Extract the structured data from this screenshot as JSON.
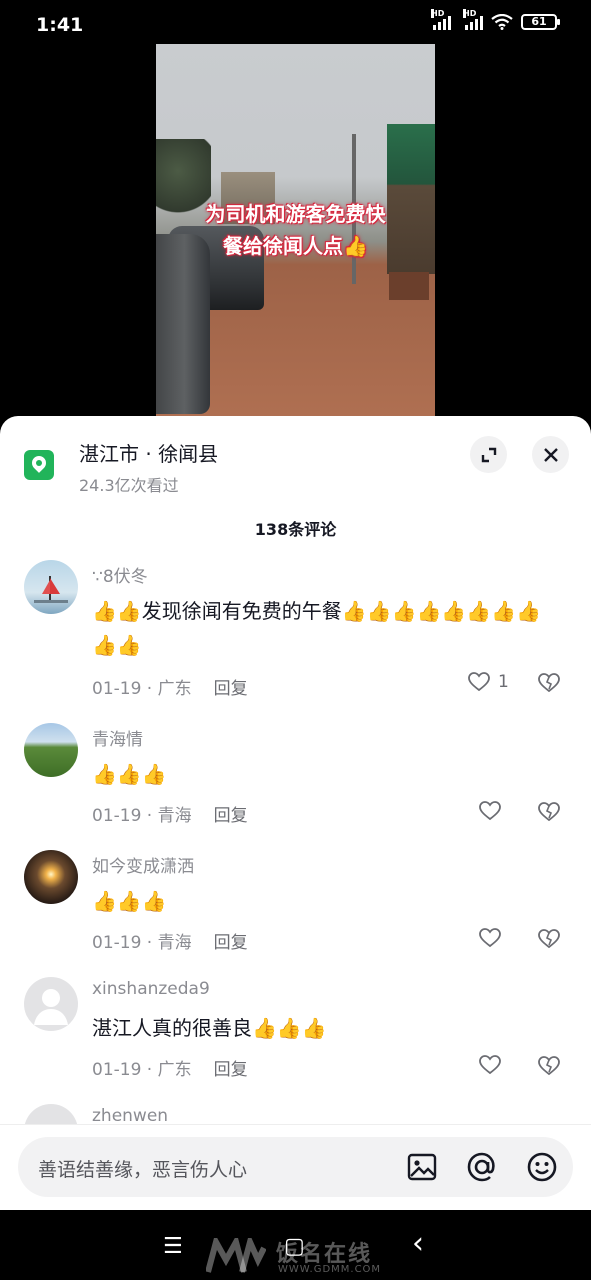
{
  "status_bar": {
    "time": "1:41",
    "signal1_label": "HD",
    "signal2_label": "HD",
    "battery": "61"
  },
  "video": {
    "caption_line1": "为司机和游客免费快",
    "caption_line2": "餐给徐闻人点👍"
  },
  "location": {
    "title": "湛江市 · 徐闻县",
    "views": "24.3亿次看过"
  },
  "comments_header": "138条评论",
  "comments": [
    {
      "user": "∵8伏冬",
      "text": "👍👍发现徐闻有免费的午餐👍👍👍👍👍👍👍👍👍👍",
      "date": "01-19",
      "region": "广东",
      "reply": "回复",
      "likes": "1"
    },
    {
      "user": "青海情",
      "text": "👍👍👍",
      "date": "01-19",
      "region": "青海",
      "reply": "回复",
      "likes": ""
    },
    {
      "user": "如今变成潇洒",
      "text": "👍👍👍",
      "date": "01-19",
      "region": "青海",
      "reply": "回复",
      "likes": ""
    },
    {
      "user": "xinshanzeda9",
      "text": "湛江人真的很善良👍👍👍",
      "date": "01-19",
      "region": "广东",
      "reply": "回复",
      "likes": ""
    },
    {
      "user": "zhenwen",
      "text": "",
      "date": "",
      "region": "",
      "reply": "",
      "likes": ""
    }
  ],
  "input": {
    "placeholder": "善语结善缘，恶言伤人心"
  },
  "nav": {
    "menu": "☰",
    "home": "▢",
    "back": "‹"
  },
  "watermark": {
    "text": "饭名在线",
    "url": "WWW.GDMM.COM"
  },
  "icons": {
    "location": "location-pin-icon",
    "expand": "expand-icon",
    "close": "close-icon",
    "like": "heart-icon",
    "dislike": "broken-heart-icon",
    "image": "image-icon",
    "mention": "at-icon",
    "emoji": "emoji-icon"
  },
  "colors": {
    "accent_green": "#21b45a",
    "text_primary": "#161823",
    "text_secondary": "#8a8b91",
    "caption_red": "#d7263d"
  }
}
